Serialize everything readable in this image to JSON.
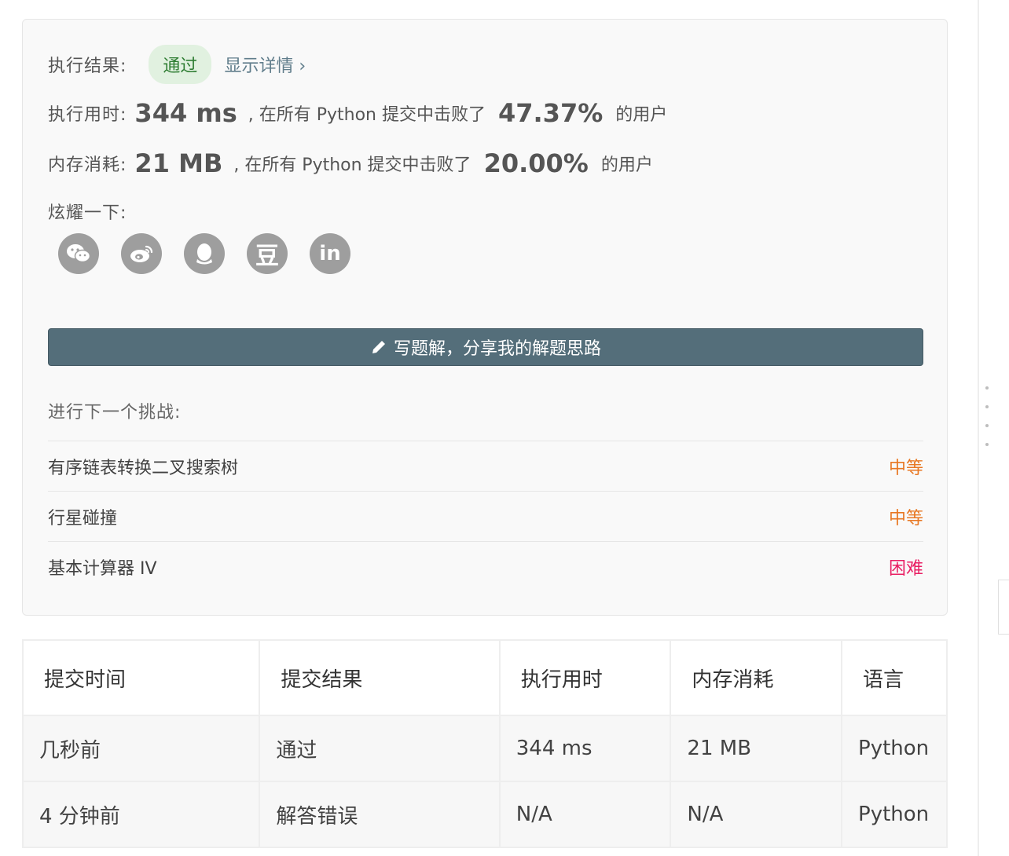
{
  "result": {
    "status_label": "执行结果:",
    "status_value": "通过",
    "details_link": "显示详情 ›",
    "runtime": {
      "label": "执行用时:",
      "value": "344 ms",
      "mid_text": ", 在所有 Python 提交中击败了",
      "percent": "47.37%",
      "suffix": "的用户"
    },
    "memory": {
      "label": "内存消耗:",
      "value": "21 MB",
      "mid_text": ", 在所有 Python 提交中击败了",
      "percent": "20.00%",
      "suffix": "的用户"
    },
    "share_label": "炫耀一下:",
    "share_icons": [
      "wechat-icon",
      "weibo-icon",
      "qq-icon",
      "douban-icon",
      "linkedin-icon"
    ],
    "douban_glyph": "豆",
    "linkedin_glyph": "in",
    "write_button": "写题解，分享我的解题思路",
    "next_label": "进行下一个挑战:",
    "challenges": [
      {
        "title": "有序链表转换二叉搜索树",
        "difficulty": "中等"
      },
      {
        "title": "行星碰撞",
        "difficulty": "中等"
      },
      {
        "title": "基本计算器 IV",
        "difficulty": "困难"
      }
    ]
  },
  "submissions": {
    "headers": [
      "提交时间",
      "提交结果",
      "执行用时",
      "内存消耗",
      "语言"
    ],
    "rows": [
      {
        "time": "几秒前",
        "result": "通过",
        "runtime": "344 ms",
        "memory": "21 MB",
        "language": "Python"
      },
      {
        "time": "4 分钟前",
        "result": "解答错误",
        "runtime": "N/A",
        "memory": "N/A",
        "language": "Python"
      }
    ]
  },
  "colors": {
    "accent_slate": "#546e7a",
    "success": "#2e7d32",
    "medium": "#e87722",
    "hard": "#e91e63",
    "error": "#c62828"
  }
}
